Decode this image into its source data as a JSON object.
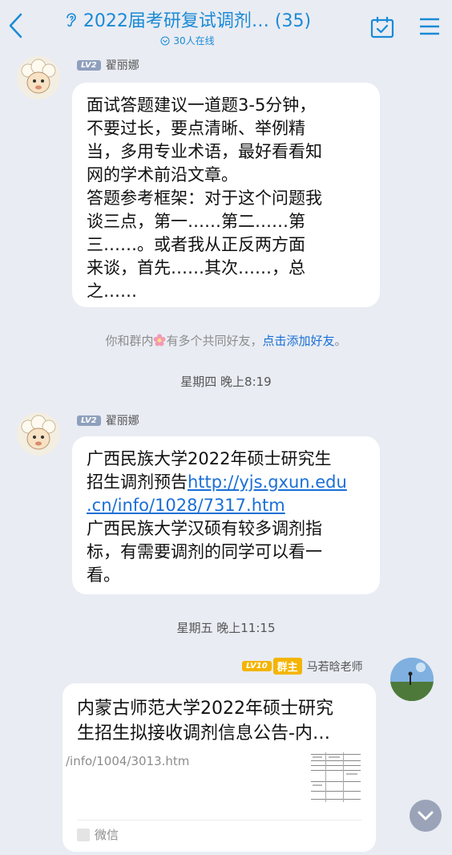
{
  "header": {
    "title": "2022届考研复试调剂… (35)",
    "online": "30人在线"
  },
  "messages": [
    {
      "level": "LV2",
      "name": "翟丽娜",
      "lines": [
        "面试答题建议一道题3-5分钟，",
        "不要过长，要点清晰、举例精",
        "当，多用专业术语，最好看看知",
        "网的学术前沿文章。",
        "答题参考框架：对于这个问题我",
        "谈三点，第一……第二……第",
        "三……。或者我从正反两方面",
        "来谈，首先……其次……，总",
        "之……"
      ]
    },
    {
      "level": "LV2",
      "name": "翟丽娜",
      "line1": "广西民族大学2022年硕士研究生",
      "line2_text": "招生调剂预告",
      "line2_link": "http://yjs.gxun.edu",
      "line3_link": ".cn/info/1028/7317.htm",
      "line4": "广西民族大学汉硕有较多调剂指",
      "line5": "标，有需要调剂的同学可以看一",
      "line6": "看。"
    }
  ],
  "system": {
    "text_before": "你和群内",
    "text_after": "有多个共同好友，",
    "link": "点击添加好友",
    "period": "。"
  },
  "times": [
    "星期四 晚上8:19",
    "星期五 晚上11:15"
  ],
  "owner_message": {
    "level": "LV10",
    "role": "群主",
    "name": "马若晗老师",
    "card": {
      "title_lines": [
        "内蒙古师范大学2022年硕士研究",
        "生招生拟接收调剂信息公告-内…"
      ],
      "url": "/info/1004/3013.htm",
      "source": "微信"
    }
  },
  "colors": {
    "accent": "#1a8ad6",
    "link": "#1a6fd6",
    "background": "#e9ecf3",
    "owner_badge": "#f4b400"
  }
}
